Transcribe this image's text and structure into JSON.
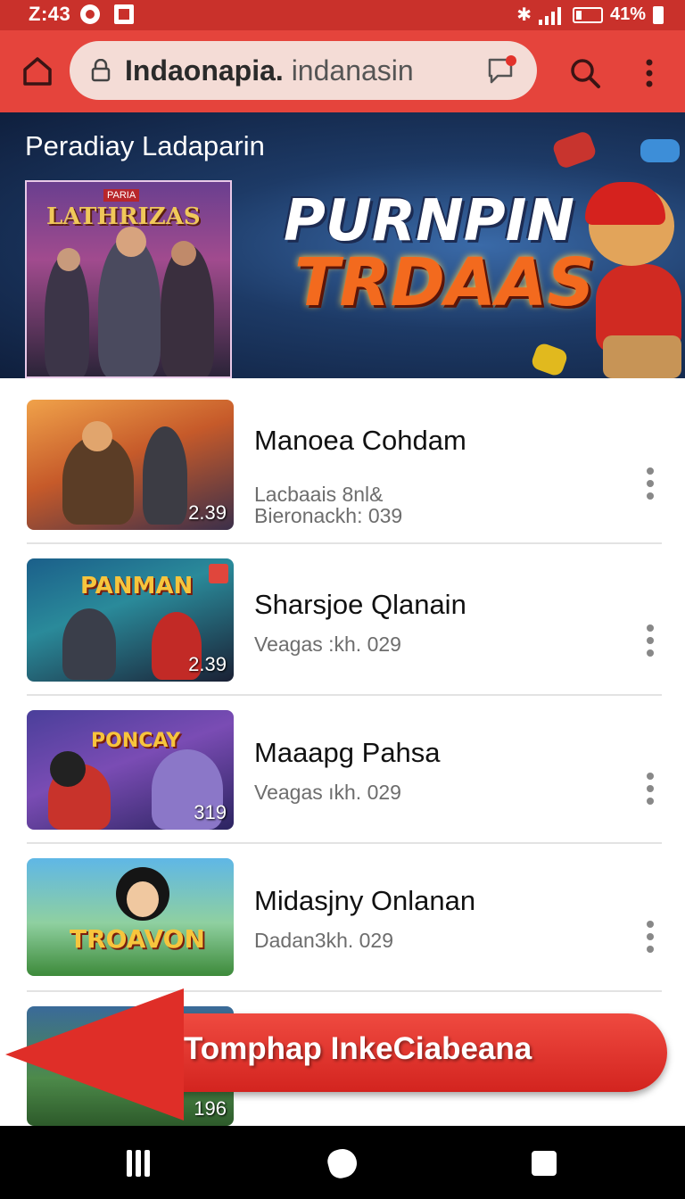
{
  "status_bar": {
    "time": "Z:43",
    "battery": "41%"
  },
  "browser": {
    "url_bold": "Indaonapia.",
    "url_rest": " indanasin"
  },
  "banner": {
    "title": "Peradiay Ladaparin",
    "poster_tag": "PARIA",
    "poster_title": "LATHRIZAS",
    "logo_line1": "PURNPIN",
    "logo_line2": "TRDAAS"
  },
  "videos": [
    {
      "title": "Manoea Cohdam",
      "sub1": "Lacbaais 8nl&",
      "sub2": "Bieronackh:  039",
      "duration": "2.39",
      "thumb_label": ""
    },
    {
      "title": "Sharsjoe Qlanain",
      "sub1": "Veagas :kh.  029",
      "sub2": "",
      "duration": "2.39",
      "thumb_label": "PANMAN"
    },
    {
      "title": "Maaapg Pahsa",
      "sub1": "Veagas ıkh.  029",
      "sub2": "",
      "duration": "319",
      "thumb_label": "PONCAY"
    },
    {
      "title": "Midasjny Onlanan",
      "sub1": "Dadan3kh.  029",
      "sub2": "",
      "duration": "",
      "thumb_label": "TROAVON"
    },
    {
      "title": "",
      "sub1": "",
      "sub2": "",
      "duration": "196",
      "thumb_label": ""
    }
  ],
  "overlay": {
    "label": "Tomphap InkeCiabeana"
  },
  "colors": {
    "status_bar": "#c9312b",
    "browser_bar": "#e5443c",
    "arrow": "#df2e28"
  }
}
